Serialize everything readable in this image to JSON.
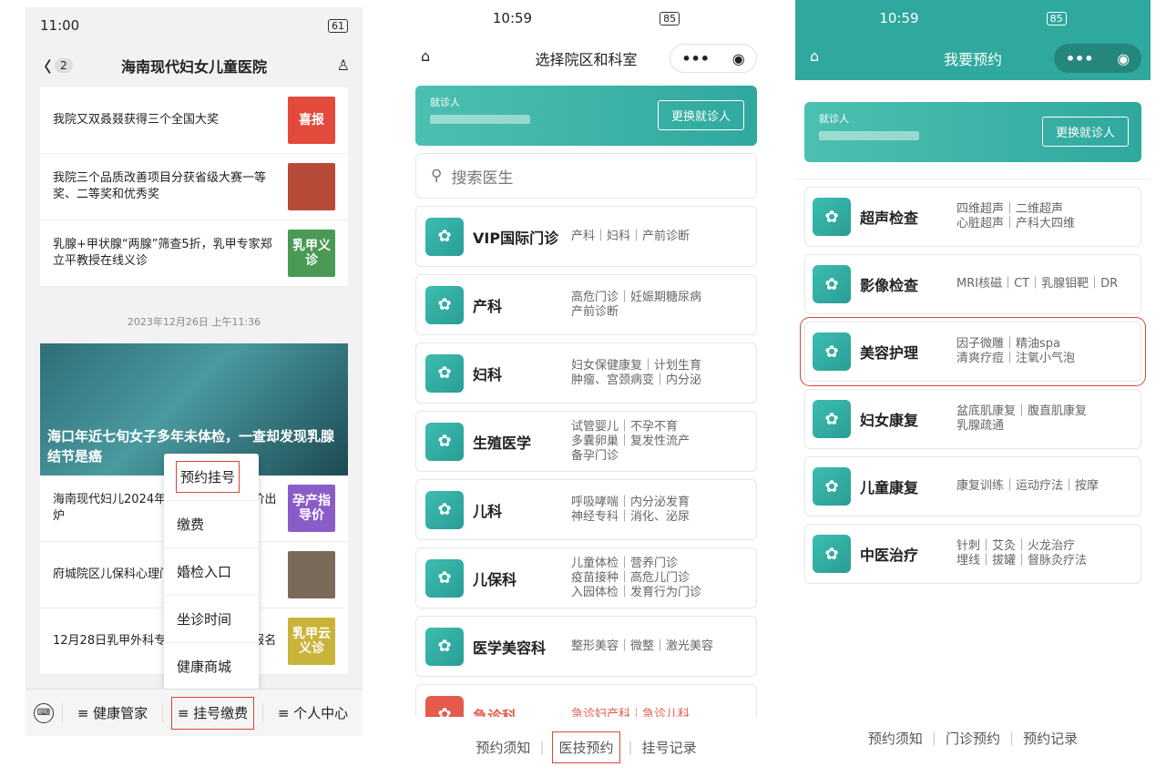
{
  "panel1": {
    "time": "11:00",
    "battery": "61",
    "title": "海南现代妇女儿童医院",
    "back_count": "2",
    "news": [
      {
        "text": "我院又双叒叕获得三个全国大奖",
        "thumb": "喜报",
        "color": "#e24a3c"
      },
      {
        "text": "我院三个品质改善项目分获省级大赛一等奖、二等奖和优秀奖",
        "thumb": "",
        "color": "#b84a3a"
      },
      {
        "text": "乳腺+甲状腺“两腺”筛查5折，乳甲专家郑立平教授在线义诊",
        "thumb": "乳甲义诊",
        "color": "#4a9a55"
      }
    ],
    "date": "2023年12月26日 上午11:36",
    "hero_title": "海口年近七旬女子多年未体检，一查却发现乳腺结节是癌",
    "news2": [
      {
        "text": "海南现代妇儿2024年孕产康/儿保指导价出炉",
        "thumb": "孕产指导价",
        "color": "#8a5cc8"
      },
      {
        "text": "府城院区儿保科心理门诊即将开诊",
        "thumb": "",
        "color": "#7a6a5a"
      },
      {
        "text": "12月28日乳甲外科专家线上义诊 免费报名",
        "thumb": "乳甲云义诊",
        "color": "#c9b43a"
      }
    ],
    "menu": [
      "预约挂号",
      "缴费",
      "婚检入口",
      "坐诊时间",
      "健康商城"
    ],
    "tabs": [
      "≡ 健康管家",
      "≡ 挂号缴费",
      "≡ 个人中心"
    ]
  },
  "panel2": {
    "time": "10:59",
    "battery": "85",
    "title": "选择院区和科室",
    "patient_label": "就诊人",
    "change_btn": "更换就诊人",
    "search_placeholder": "搜索医生",
    "depts": [
      {
        "icon": "vip-icon",
        "name": "VIP国际门诊",
        "desc": [
          "产科｜妇科｜产前诊断"
        ]
      },
      {
        "icon": "obstetrics-icon",
        "name": "产科",
        "desc": [
          "高危门诊｜妊娠期糖尿病",
          "产前诊断"
        ]
      },
      {
        "icon": "gynecology-icon",
        "name": "妇科",
        "desc": [
          "妇女保健康复｜计划生育",
          "肿瘤、宫颈病变｜内分泌"
        ]
      },
      {
        "icon": "reproductive-icon",
        "name": "生殖医学",
        "desc": [
          "试管婴儿｜不孕不育",
          "多囊卵巢｜复发性流产",
          "备孕门诊"
        ]
      },
      {
        "icon": "pediatrics-icon",
        "name": "儿科",
        "desc": [
          "呼吸哮喘｜内分泌发育",
          "神经专科｜消化、泌尿"
        ]
      },
      {
        "icon": "child-care-icon",
        "name": "儿保科",
        "desc": [
          "儿童体检｜营养门诊",
          "疫苗接种｜高危儿门诊",
          "入园体检｜发育行为门诊"
        ]
      },
      {
        "icon": "cosmetic-icon",
        "name": "医学美容科",
        "desc": [
          "整形美容｜微整｜激光美容"
        ]
      },
      {
        "icon": "emergency-icon",
        "name": "急诊科",
        "desc": [
          "急诊妇产科｜急诊儿科"
        ]
      }
    ],
    "bottom": [
      "预约须知",
      "医技预约",
      "挂号记录"
    ]
  },
  "panel3": {
    "time": "10:59",
    "battery": "85",
    "title": "我要预约",
    "patient_label": "就诊人",
    "change_btn": "更换就诊人",
    "services": [
      {
        "icon": "ultrasound-icon",
        "name": "超声检查",
        "desc": [
          "四维超声｜二维超声",
          "心脏超声｜产科大四维"
        ]
      },
      {
        "icon": "imaging-icon",
        "name": "影像检查",
        "desc": [
          "MRI核磁｜CT｜乳腺钼靶｜DR"
        ]
      },
      {
        "icon": "beauty-icon",
        "name": "美容护理",
        "desc": [
          "因子微雕｜精油spa",
          "清爽疗痘｜注氧小气泡"
        ]
      },
      {
        "icon": "women-rehab-icon",
        "name": "妇女康复",
        "desc": [
          "盆底肌康复｜腹直肌康复",
          "乳腺疏通"
        ]
      },
      {
        "icon": "child-rehab-icon",
        "name": "儿童康复",
        "desc": [
          "康复训练｜运动疗法｜按摩"
        ]
      },
      {
        "icon": "tcm-icon",
        "name": "中医治疗",
        "desc": [
          "针刺｜艾灸｜火龙治疗",
          "埋线｜拔罐｜督脉灸疗法"
        ]
      }
    ],
    "bottom": [
      "预约须知",
      "门诊预约",
      "预约记录"
    ]
  }
}
